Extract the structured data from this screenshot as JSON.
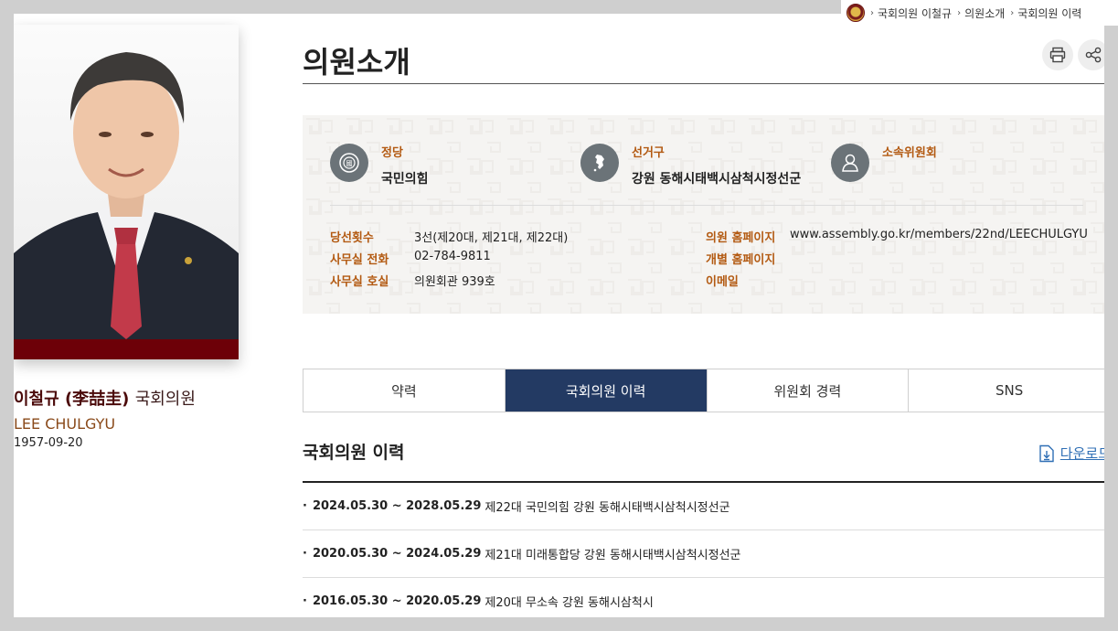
{
  "breadcrumb": [
    "국회의원 이철규",
    "의원소개",
    "국회의원 이력"
  ],
  "profile": {
    "name_ko": "이철규 (李喆圭)",
    "title": "국회의원",
    "name_en": "LEE CHULGYU",
    "birth": "1957-09-20"
  },
  "page_title": "의원소개",
  "info": {
    "categories": [
      {
        "label": "정당",
        "value": "국민의힘",
        "icon": "party-emblem-icon"
      },
      {
        "label": "선거구",
        "value": "강원 동해시태백시삼척시정선군",
        "icon": "district-map-icon"
      },
      {
        "label": "소속위원회",
        "value": "",
        "icon": "person-icon"
      }
    ],
    "left_rows": [
      {
        "key": "당선횟수",
        "value": "3선(제20대, 제21대, 제22대)"
      },
      {
        "key": "사무실 전화",
        "value": "02-784-9811"
      },
      {
        "key": "사무실 호실",
        "value": "의원회관 939호"
      }
    ],
    "right_rows": [
      {
        "key": "의원 홈페이지",
        "value": "www.assembly.go.kr/members/22nd/LEECHULGYU"
      },
      {
        "key": "개별 홈페이지",
        "value": ""
      },
      {
        "key": "이메일",
        "value": ""
      }
    ]
  },
  "tabs": [
    "약력",
    "국회의원 이력",
    "위원회 경력",
    "SNS"
  ],
  "active_tab": 1,
  "history": {
    "title": "국회의원 이력",
    "download_label": "다운로드",
    "items": [
      {
        "date": "2024.05.30 ~ 2028.05.29",
        "desc": "제22대 국민의힘 강원 동해시태백시삼척시정선군"
      },
      {
        "date": "2020.05.30 ~ 2024.05.29",
        "desc": "제21대 미래통합당 강원 동해시태백시삼척시정선군"
      },
      {
        "date": "2016.05.30 ~ 2020.05.29",
        "desc": "제20대 무소속 강원 동해시삼척시"
      }
    ]
  },
  "colors": {
    "accent_navy": "#233a63",
    "label_orange": "#b35a12",
    "name_maroon": "#4b0a0a",
    "photo_band": "#6d0008",
    "link_blue": "#2f6fb5"
  }
}
